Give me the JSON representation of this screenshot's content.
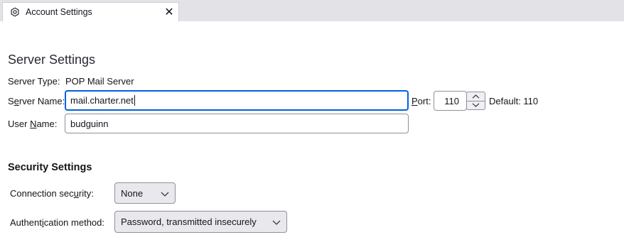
{
  "tab": {
    "title": "Account Settings",
    "icon": "gear-icon",
    "close_icon": "close-icon",
    "close_glyph": "✕"
  },
  "server": {
    "heading": "Server Settings",
    "type_label": "Server Type:",
    "type_value": "POP Mail Server",
    "name_label_pre": "S",
    "name_label_u": "e",
    "name_label_post": "rver Name:",
    "name_value": "mail.charter.net",
    "port_label_u": "P",
    "port_label_post": "ort:",
    "port_value": "110",
    "default_label": "Default: 110",
    "user_label_pre": "User ",
    "user_label_u": "N",
    "user_label_post": "ame:",
    "user_value": "budguinn"
  },
  "security": {
    "heading": "Security Settings",
    "conn_label_pre": "Connection sec",
    "conn_label_u": "u",
    "conn_label_post": "rity:",
    "conn_value": "None",
    "auth_label_pre": "Authent",
    "auth_label_u": "i",
    "auth_label_post": "cation method:",
    "auth_value": "Password, transmitted insecurely"
  },
  "colors": {
    "focus": "#0061e0",
    "tabbar": "#e3e3e7"
  }
}
